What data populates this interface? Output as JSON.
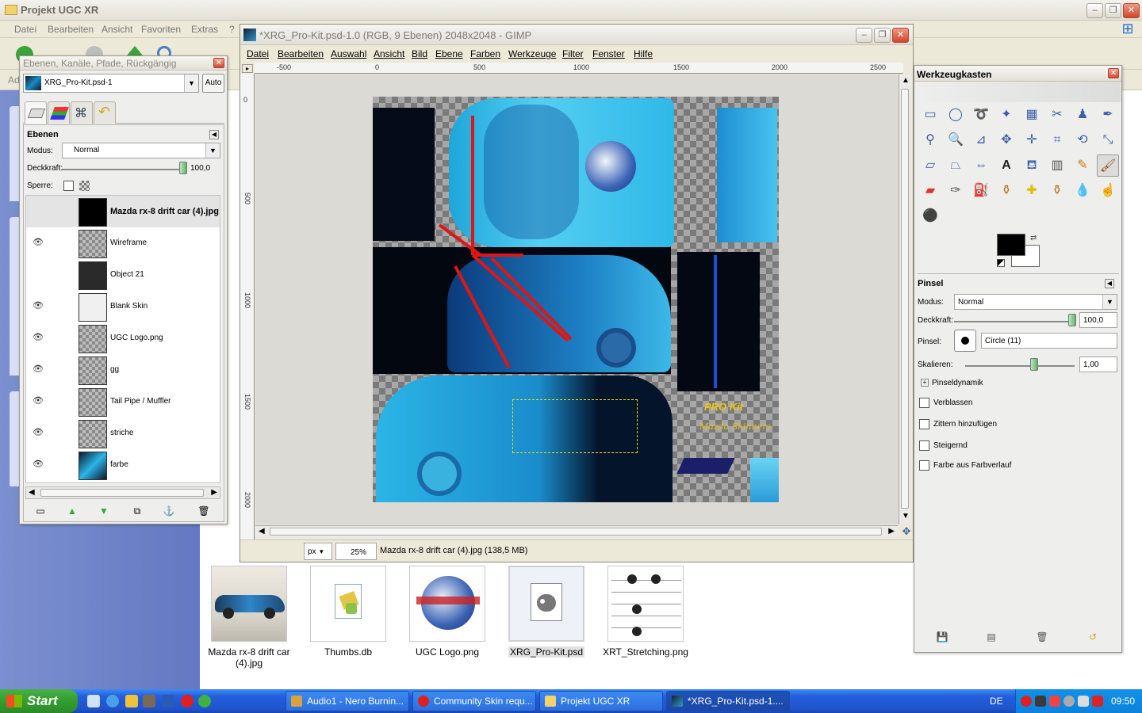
{
  "explorer": {
    "title": "Projekt UGC XR",
    "menu": [
      "Datei",
      "Bearbeiten",
      "Ansicht",
      "Favoriten",
      "Extras",
      "?"
    ],
    "address_label": "Ad",
    "files": [
      {
        "name": "Mazda rx-8 drift car (4).jpg",
        "icon": "car-photo-thumb"
      },
      {
        "name": "Thumbs.db",
        "icon": "db-file-icon"
      },
      {
        "name": "UGC Logo.png",
        "icon": "ugc-logo-thumb"
      },
      {
        "name": "XRG_Pro-Kit.psd",
        "icon": "gimp-file-icon",
        "selected": true
      },
      {
        "name": "XRT_Stretching.png",
        "icon": "stretching-thumb"
      }
    ]
  },
  "layers_dialog": {
    "title": "Ebenen, Kanäle, Pfade, Rückgängig",
    "image_select": "XRG_Pro-Kit.psd-1",
    "auto_label": "Auto",
    "panel_title": "Ebenen",
    "mode_label": "Modus:",
    "mode_value": "Normal",
    "opacity_label": "Deckkraft:",
    "opacity_value": "100,0",
    "lock_label": "Sperre:",
    "layers": [
      {
        "name": "Mazda rx-8 drift car (4).jpg",
        "visible": false,
        "active": true
      },
      {
        "name": "Wireframe",
        "visible": true
      },
      {
        "name": "Object 21",
        "visible": false
      },
      {
        "name": "Blank Skin",
        "visible": true
      },
      {
        "name": "UGC Logo.png",
        "visible": true
      },
      {
        "name": "gg",
        "visible": true
      },
      {
        "name": "Tail Pipe / Muffler",
        "visible": true
      },
      {
        "name": "striche",
        "visible": true
      },
      {
        "name": "farbe",
        "visible": true
      }
    ]
  },
  "image_window": {
    "title": "*XRG_Pro-Kit.psd-1.0 (RGB, 9 Ebenen) 2048x2048 - GIMP",
    "menu": [
      "Datei",
      "Bearbeiten",
      "Auswahl",
      "Ansicht",
      "Bild",
      "Ebene",
      "Farben",
      "Werkzeuge",
      "Filter",
      "Fenster",
      "Hilfe"
    ],
    "ruler_h": [
      "-500",
      "0",
      "500",
      "1000",
      "1500",
      "2000",
      "2500"
    ],
    "ruler_v": [
      "0",
      "500",
      "1000",
      "1500",
      "2000"
    ],
    "unit": "px",
    "zoom": "25%",
    "status": "Mazda rx-8 drift car (4).jpg (138,5 MB)",
    "texture_text": [
      "PRO Kit",
      "Mazda Skinners"
    ]
  },
  "toolbox": {
    "title": "Werkzeugkasten",
    "options_title": "Pinsel",
    "mode_label": "Modus:",
    "mode_value": "Normal",
    "opacity_label": "Deckkraft:",
    "opacity_value": "100,0",
    "brush_label": "Pinsel:",
    "brush_value": "Circle (11)",
    "scale_label": "Skalieren:",
    "scale_value": "1,00",
    "dynamics_label": "Pinseldynamik",
    "checkboxes": [
      "Verblassen",
      "Zittern hinzufügen",
      "Steigernd",
      "Farbe aus Farbverlauf"
    ]
  },
  "taskbar": {
    "start_label": "Start",
    "tasks": [
      "Audio1 - Nero Burnin...",
      "Community Skin requ...",
      "Projekt UGC XR",
      "*XRG_Pro-Kit.psd-1...."
    ],
    "language": "DE",
    "clock": "09:50"
  },
  "colors": {
    "xp_blue": "#245edb",
    "start_green": "#36a131",
    "car_cyan": "#2bb5e6",
    "wire_blue": "#1e4fd0",
    "red_lines": "#e01515"
  }
}
